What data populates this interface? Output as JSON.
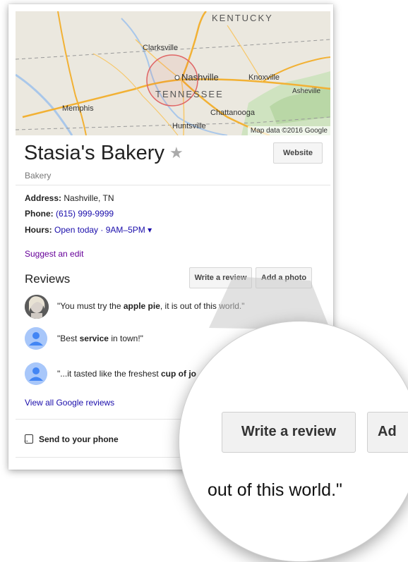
{
  "map": {
    "labels": {
      "kentucky": "KENTUCKY",
      "clarksville": "Clarksville",
      "nashville": "Nashville",
      "knoxville": "Knoxville",
      "asheville": "Asheville",
      "tennessee": "TENNESSEE",
      "memphis": "Memphis",
      "chattanooga": "Chattanooga",
      "huntsville": "Huntsville"
    },
    "credit": "Map data ©2016 Google"
  },
  "business": {
    "name": "Stasia's Bakery",
    "category": "Bakery",
    "website_label": "Website",
    "address_label": "Address:",
    "address_value": "Nashville, TN",
    "phone_label": "Phone:",
    "phone_value": "(615) 999-9999",
    "hours_label": "Hours:",
    "hours_value": "Open today · 9AM–5PM ▾",
    "suggest_edit": "Suggest an edit"
  },
  "reviews": {
    "heading": "Reviews",
    "write_label": "Write a review",
    "add_photo_label": "Add a photo",
    "items": [
      {
        "pre": "\"You must try the ",
        "bold": "apple pie",
        "post": ", it is out of this world.\""
      },
      {
        "pre": "\"Best ",
        "bold": "service",
        "post": " in town!\""
      },
      {
        "pre": "\"...it tasted like the freshest ",
        "bold": "cup of jo",
        "post": ""
      }
    ],
    "view_all": "View all Google reviews"
  },
  "send": {
    "label": "Send to your phone"
  },
  "magnifier": {
    "button_label": "Write a review",
    "next_button_label": "Ad",
    "text": "out of this world.\""
  },
  "colors": {
    "link": "#1a0dab",
    "visited": "#660099",
    "avatar": "#a8c7fa"
  }
}
